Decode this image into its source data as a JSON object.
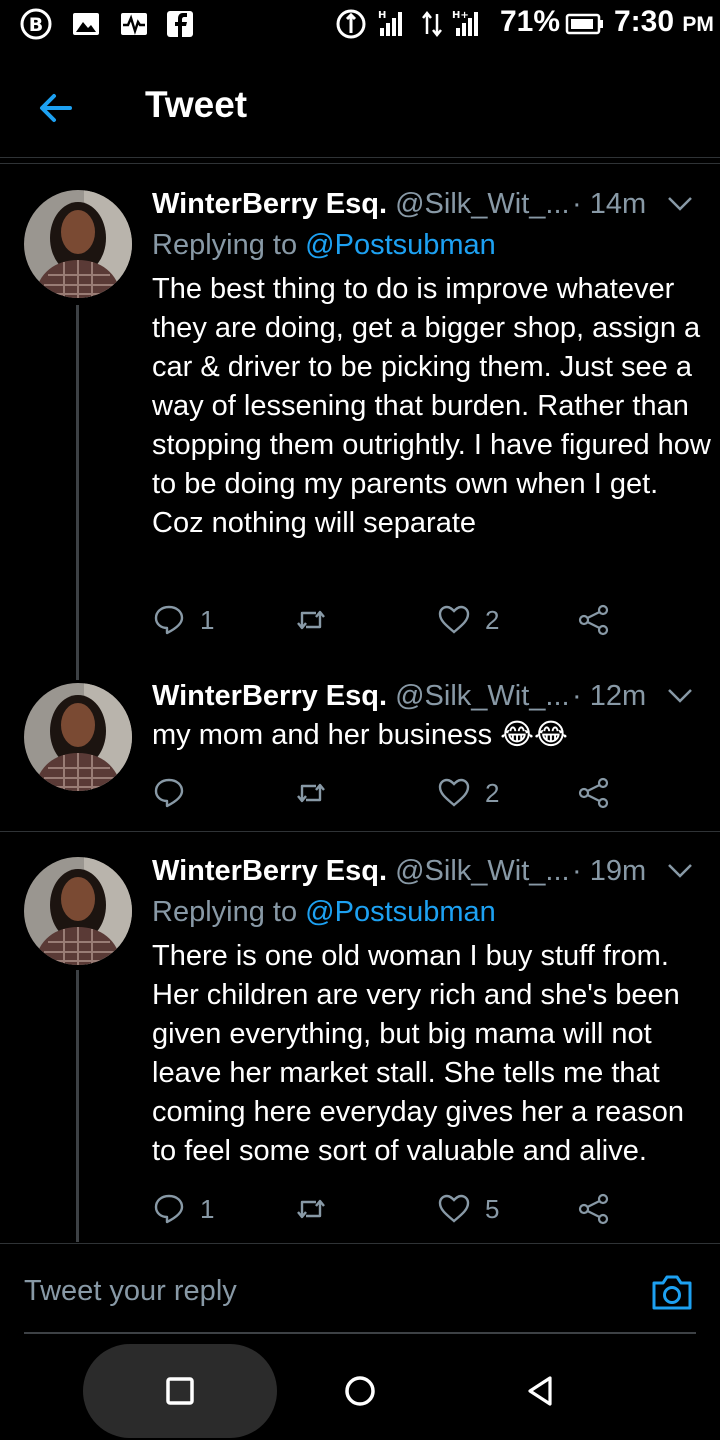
{
  "status_bar": {
    "battery": "71%",
    "time": "7:30",
    "ampm": "PM"
  },
  "header": {
    "title": "Tweet",
    "back_icon": "arrow-left-icon"
  },
  "tweets": [
    {
      "name": "WinterBerry Esq.",
      "handle": "@Silk_Wit_...",
      "time": "· 14m",
      "reply_prefix": "Replying to",
      "reply_mention": "@Postsubman",
      "text": "The best thing to do is improve whatever they are doing, get a bigger shop, assign a car & driver to be picking them. Just see a way of lessening that burden. Rather than stopping them outrightly. I have figured how to be doing my parents own when I get. Coz nothing will separate",
      "replies": "1",
      "retweets": "",
      "likes": "2"
    },
    {
      "name": "WinterBerry Esq.",
      "handle": "@Silk_Wit_...",
      "time": "· 12m",
      "text": "my mom and her business 😂😂",
      "replies": "",
      "retweets": "",
      "likes": "2"
    },
    {
      "name": "WinterBerry Esq.",
      "handle": "@Silk_Wit_...",
      "time": "· 19m",
      "reply_prefix": "Replying to",
      "reply_mention": "@Postsubman",
      "text": "There is one old woman I buy stuff from. Her children are very rich and she's been given everything, but big mama will not leave her market stall. She tells me that coming here everyday gives her a reason to feel some sort of valuable and alive.",
      "replies": "1",
      "retweets": "",
      "likes": "5"
    }
  ],
  "reply_bar": {
    "placeholder": "Tweet your reply"
  },
  "colors": {
    "background": "#000000",
    "accent": "#1da1f2",
    "secondary_text": "#8899a6"
  }
}
